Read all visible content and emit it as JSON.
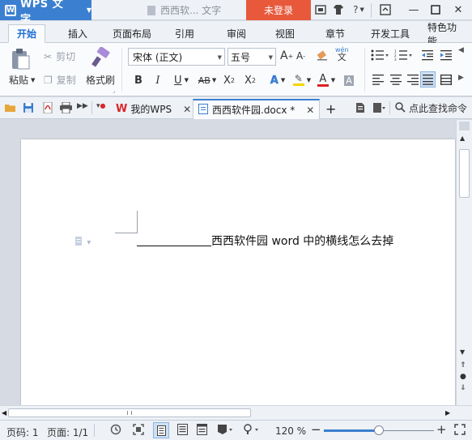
{
  "titlebar": {
    "app_name": "WPS 文字",
    "doc_title": "西西软... 文字",
    "login_label": "未登录"
  },
  "ribbon_tabs": [
    "开始",
    "插入",
    "页面布局",
    "引用",
    "审阅",
    "视图",
    "章节",
    "开发工具",
    "特色功能"
  ],
  "clipboard": {
    "paste_label": "粘贴",
    "cut_label": "剪切",
    "copy_label": "复制",
    "format_painter_label": "格式刷"
  },
  "font": {
    "family_value": "宋体 (正文)",
    "size_value": "五号",
    "pinyin_label": "wén"
  },
  "quickbar": {
    "wps_tab_label": "我的WPS",
    "doc_tab_label": "西西软件园.docx *",
    "search_label": "点此查找命令"
  },
  "document": {
    "text": "西西软件园 word 中的横线怎么去掉"
  },
  "status": {
    "page_label": "页码: 1",
    "pages_label": "页面: 1/1",
    "zoom_label": "120 %",
    "zoom_level": 0.5
  },
  "colors": {
    "app_button": "#3b7fd0",
    "login_button": "#e8593c",
    "active_tab_text": "#1f6fd4",
    "highlight_yellow": "#f2d600",
    "font_color_red": "#e02020",
    "wps_logo_red": "#d9262b"
  }
}
